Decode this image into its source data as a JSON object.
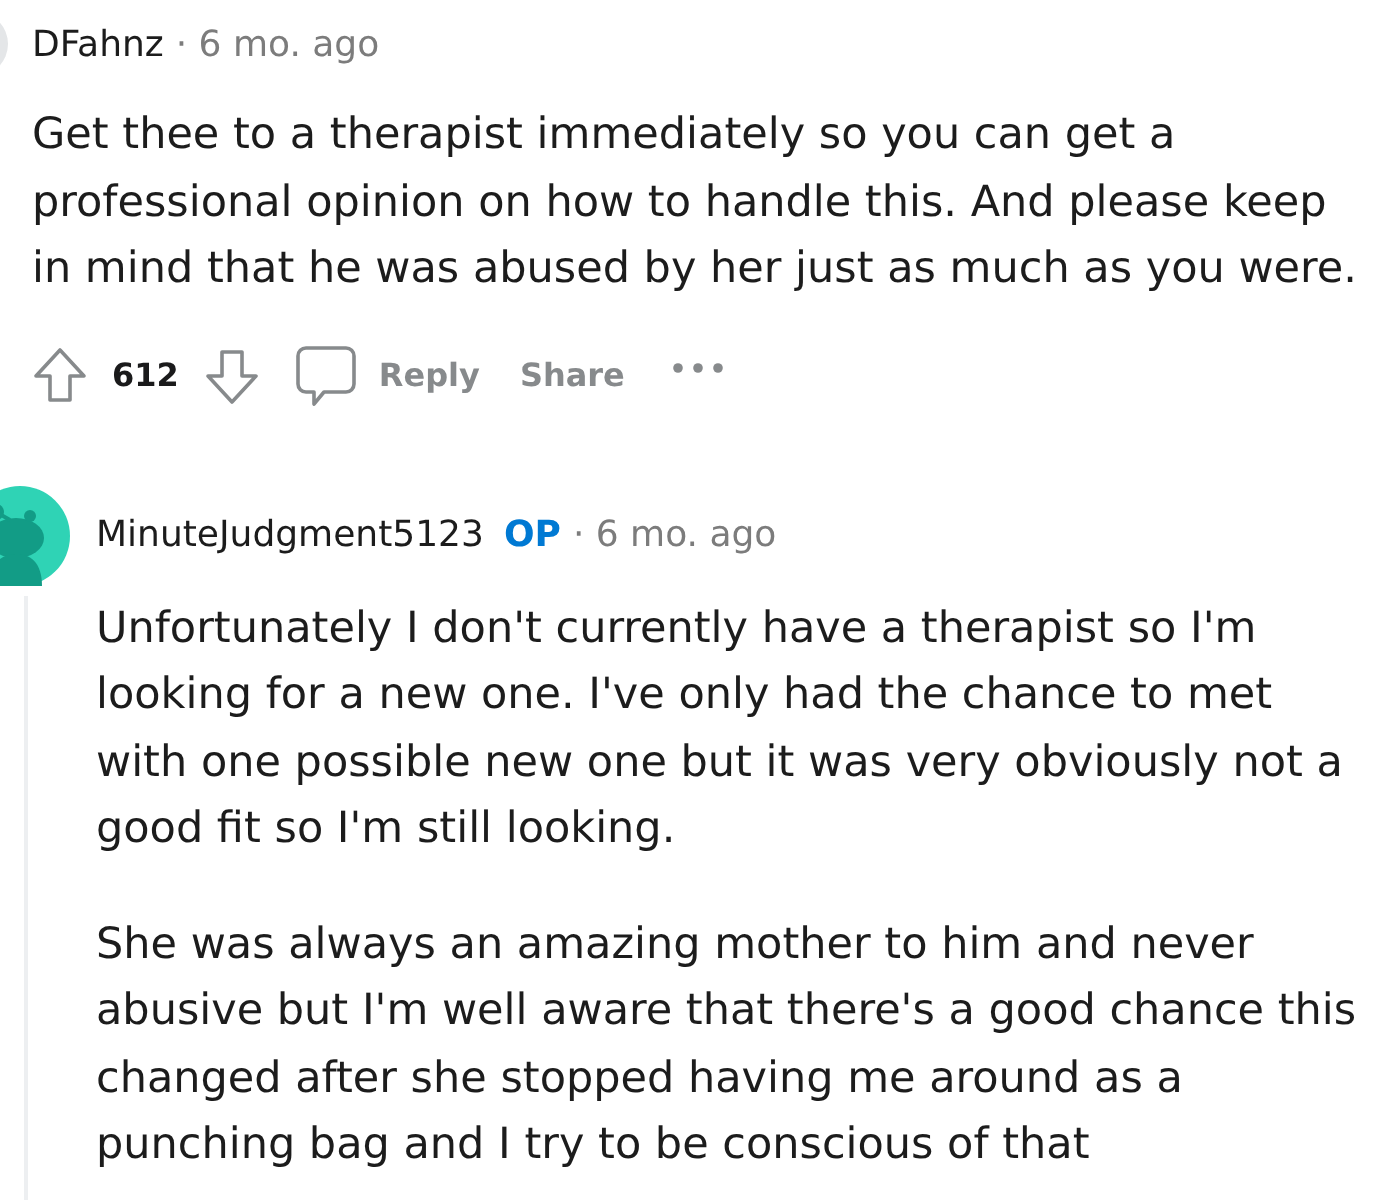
{
  "comment": {
    "author": "DFahnz",
    "meta": "· 6 mo. ago",
    "paragraphs": [
      "Get thee to a therapist immediately so you can get a professional opinion on how to handle this. And please keep in mind that he was abused by her just as much as you were."
    ],
    "actions": {
      "votes": "612",
      "reply": "Reply",
      "share": "Share"
    }
  },
  "reply": {
    "author": "MinuteJudgment5123",
    "badge": "OP",
    "meta": "· 6 mo. ago",
    "paragraphs": [
      "Unfortunately I don't currently have a therapist so I'm looking for a new one. I've only had the chance to met with one possible new one but it was very obviously not a good fit so I'm still looking.",
      "She was always an amazing mother to him and never abusive but I'm well aware that there's a good chance this changed after she stopped having me around as a punching bag and I try to be conscious of that"
    ]
  }
}
